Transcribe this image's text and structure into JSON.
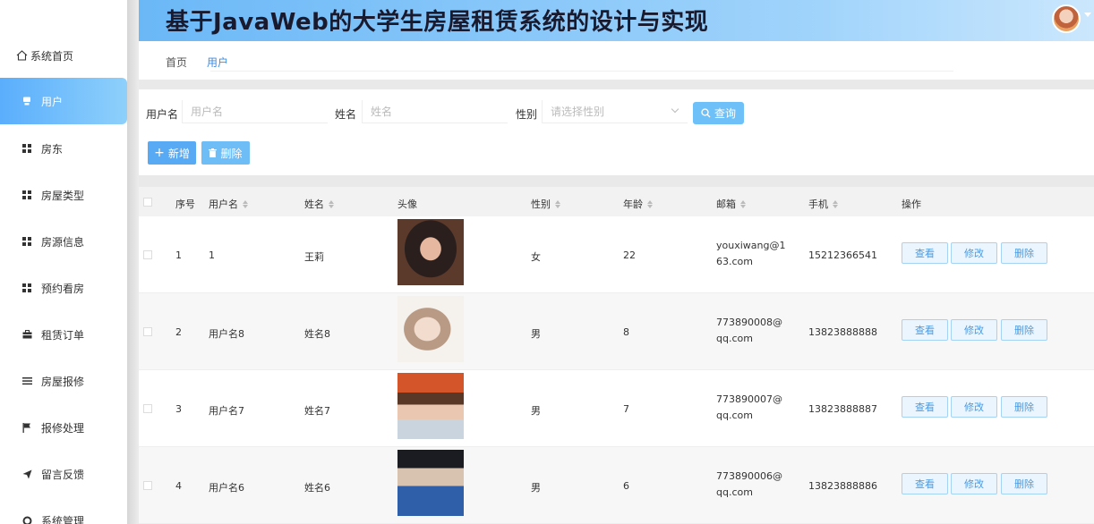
{
  "app": {
    "title": "基于JavaWeb的大学生房屋租赁系统的设计与实现"
  },
  "sidebar": {
    "items": [
      {
        "label": "系统首页",
        "icon": "home-icon"
      },
      {
        "label": "用户",
        "icon": "user-icon",
        "active": true
      },
      {
        "label": "房东",
        "icon": "grid-icon"
      },
      {
        "label": "房屋类型",
        "icon": "grid-icon"
      },
      {
        "label": "房源信息",
        "icon": "grid-icon"
      },
      {
        "label": "预约看房",
        "icon": "grid-icon"
      },
      {
        "label": "租赁订单",
        "icon": "briefcase-icon"
      },
      {
        "label": "房屋报修",
        "icon": "list-icon"
      },
      {
        "label": "报修处理",
        "icon": "flag-icon"
      },
      {
        "label": "留言反馈",
        "icon": "send-icon"
      },
      {
        "label": "系统管理",
        "icon": "gear-icon"
      }
    ]
  },
  "breadcrumb": {
    "home": "首页",
    "current": "用户"
  },
  "search": {
    "username_label": "用户名",
    "username_placeholder": "用户名",
    "name_label": "姓名",
    "name_placeholder": "姓名",
    "gender_label": "性别",
    "gender_placeholder": "请选择性别",
    "query_button": "查询"
  },
  "actions": {
    "add": "新增",
    "delete": "删除"
  },
  "table": {
    "columns": [
      "序号",
      "用户名",
      "姓名",
      "头像",
      "性别",
      "年龄",
      "邮箱",
      "手机",
      "操作"
    ],
    "op_labels": {
      "view": "查看",
      "edit": "修改",
      "delete": "删除"
    },
    "rows": [
      {
        "index": "1",
        "username": "1",
        "name": "王莉",
        "gender": "女",
        "age": "22",
        "email": "youxiwang@163.com",
        "phone": "15212366541",
        "photo_colors": [
          "#2a1f1d",
          "#d8a58c",
          "#5b3a2c"
        ]
      },
      {
        "index": "2",
        "username": "用户名8",
        "name": "姓名8",
        "gender": "男",
        "age": "8",
        "email": "773890008@qq.com",
        "phone": "13823888888",
        "photo_colors": [
          "#e9e3de",
          "#b89a85",
          "#f5f1ec"
        ]
      },
      {
        "index": "3",
        "username": "用户名7",
        "name": "姓名7",
        "gender": "男",
        "age": "7",
        "email": "773890007@qq.com",
        "phone": "13823888887",
        "photo_colors": [
          "#d4552a",
          "#5a3828",
          "#c9d4df"
        ]
      },
      {
        "index": "4",
        "username": "用户名6",
        "name": "姓名6",
        "gender": "男",
        "age": "6",
        "email": "773890006@qq.com",
        "phone": "13823888886",
        "photo_colors": [
          "#2f5fa8",
          "#1b1b22",
          "#d8c2b0"
        ]
      }
    ]
  }
}
